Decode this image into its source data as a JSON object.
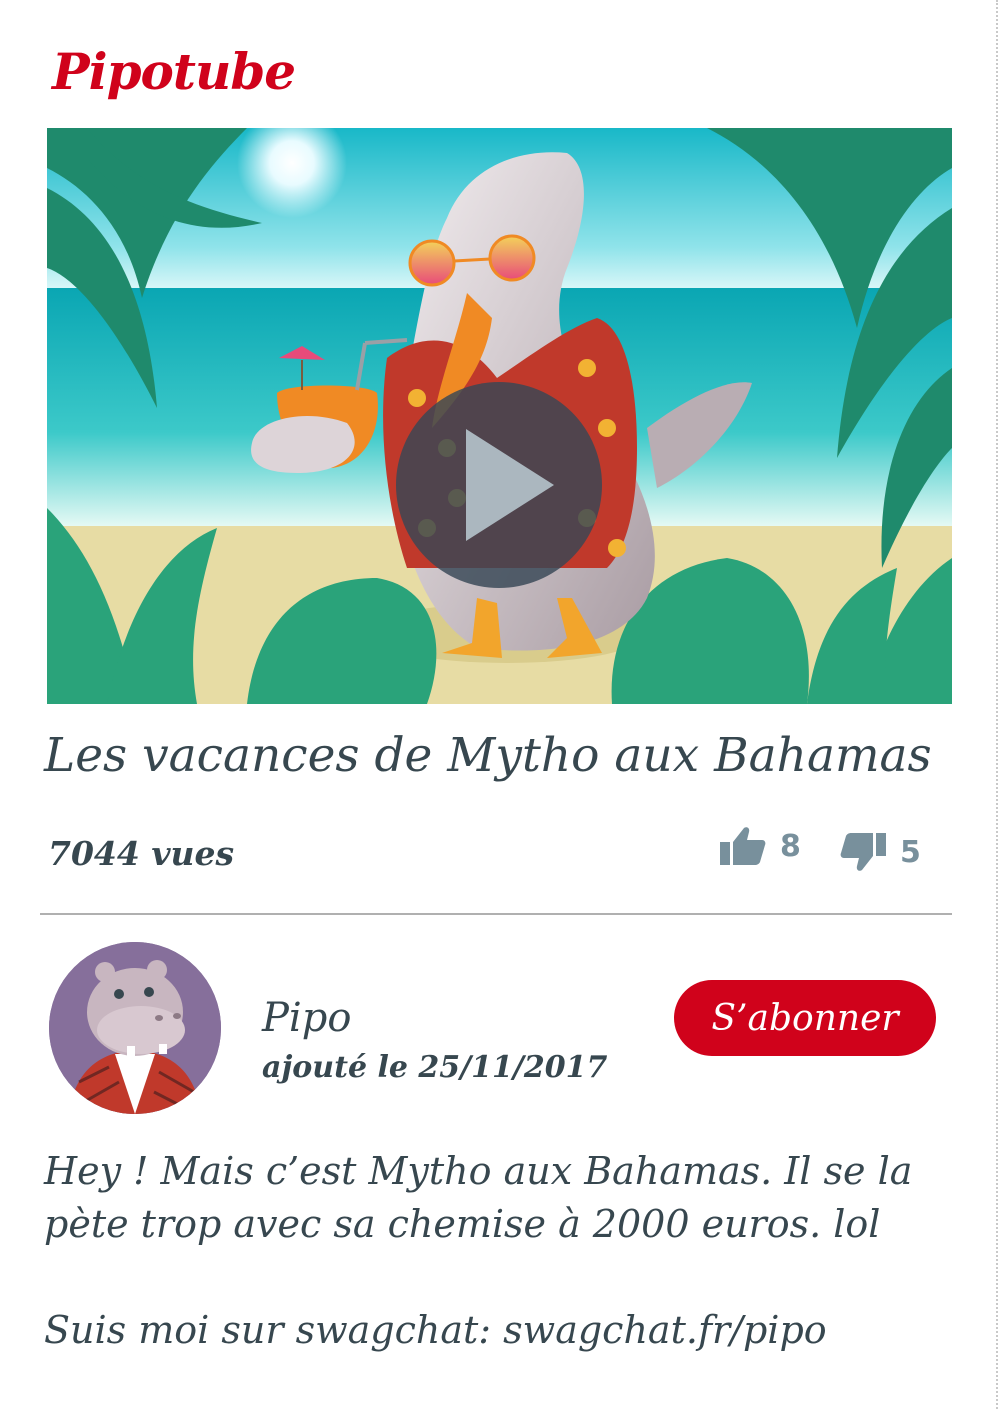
{
  "app": {
    "brand": "Pipotube"
  },
  "video": {
    "title": "Les vacances de Mytho aux Bahamas",
    "views": "7044 vues",
    "likes": "8",
    "dislikes": "5"
  },
  "channel": {
    "name": "Pipo",
    "added": "ajouté le 25/11/2017",
    "subscribe_label": "S’abonner"
  },
  "description": {
    "line1": "Hey ! Mais c’est Mytho aux Bahamas. Il se la",
    "line2": "pète trop avec sa chemise à 2000 euros. lol",
    "line3": "Suis moi sur swagchat: swagchat.fr/pipo"
  },
  "colors": {
    "brand": "#d0021b",
    "text": "#37474f",
    "muted": "#78909c",
    "play_overlay": "#374756"
  },
  "icons": [
    "play-icon",
    "thumbs-up-icon",
    "thumbs-down-icon"
  ]
}
